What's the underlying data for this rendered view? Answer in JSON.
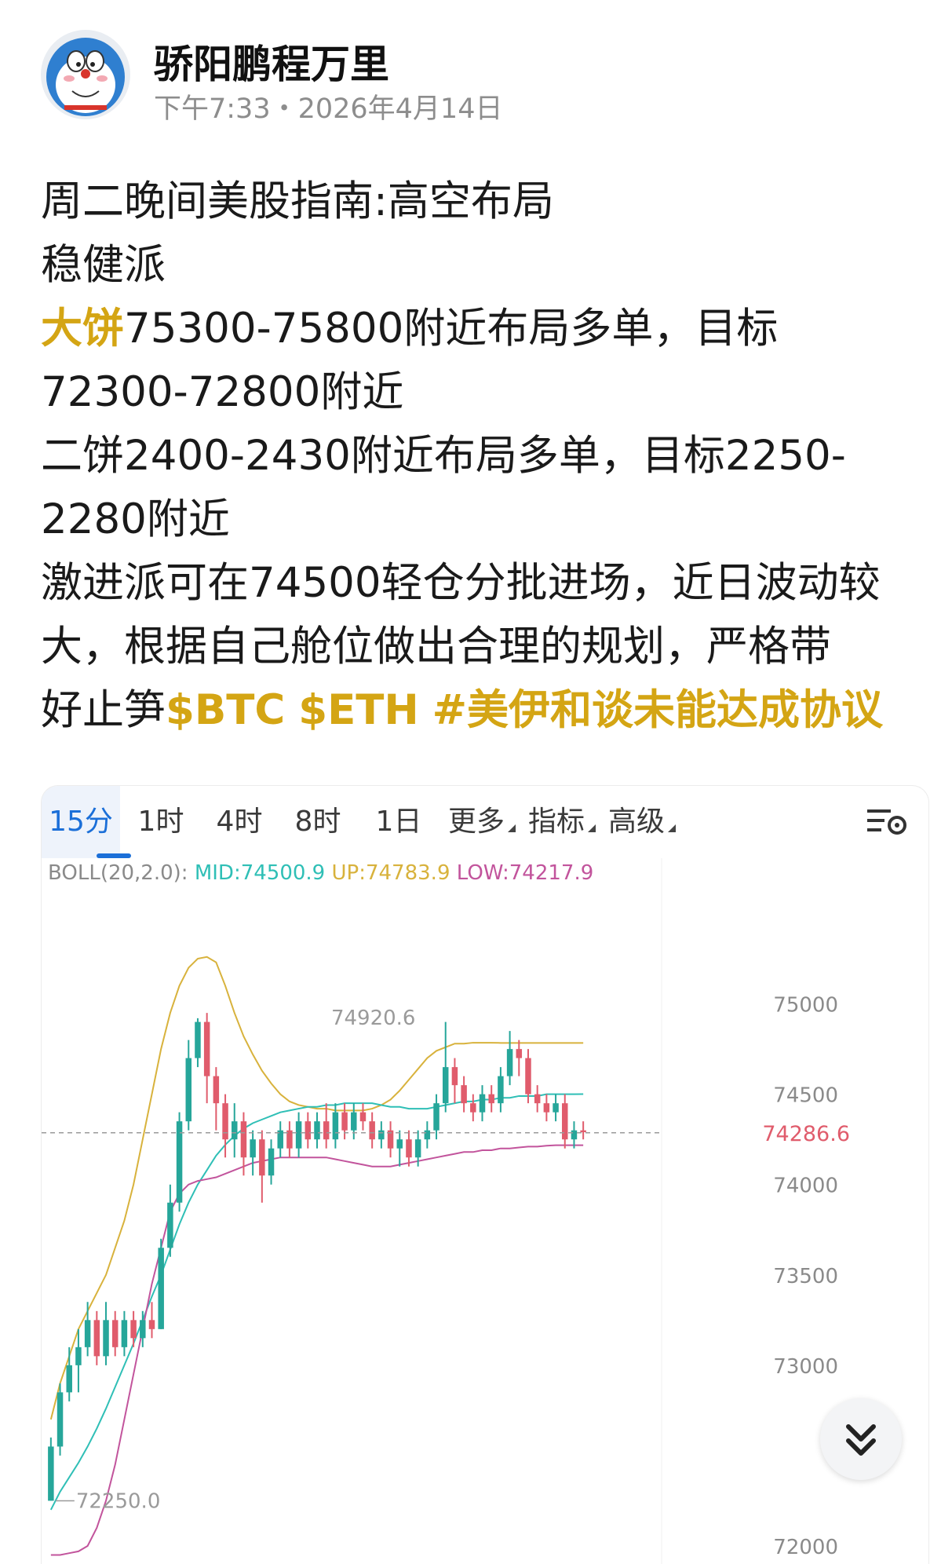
{
  "author": {
    "name": "骄阳鹏程万里",
    "time": "下午7:33・2026年4月14日"
  },
  "post": {
    "lines": [
      {
        "segments": [
          {
            "text": "周二晚间美股指南:高空布局"
          }
        ]
      },
      {
        "segments": [
          {
            "text": "稳健派"
          }
        ]
      },
      {
        "segments": [
          {
            "text": "大饼",
            "style": "hl"
          },
          {
            "text": "75300-75800附近布局多单，目标"
          }
        ]
      },
      {
        "segments": [
          {
            "text": "72300-72800附近"
          }
        ]
      },
      {
        "segments": [
          {
            "text": "二饼2400-2430附近布局多单，目标2250-"
          }
        ]
      },
      {
        "segments": [
          {
            "text": "2280附近"
          }
        ]
      },
      {
        "segments": [
          {
            "text": "激进派可在74500轻仓分批进场，近日波动较"
          }
        ]
      },
      {
        "segments": [
          {
            "text": "大，根据自己舱位做出合理的规划，严格带"
          }
        ]
      },
      {
        "segments": [
          {
            "text": "好止笋"
          },
          {
            "text": "$BTC",
            "style": "tag"
          },
          {
            "text": " "
          },
          {
            "text": "$ETH",
            "style": "tag"
          },
          {
            "text": " "
          },
          {
            "text": "#美伊和谈未能达成协议",
            "style": "tag"
          }
        ]
      }
    ]
  },
  "chart_tabs": [
    {
      "label": "15分",
      "active": true
    },
    {
      "label": "1时"
    },
    {
      "label": "4时"
    },
    {
      "label": "8时"
    },
    {
      "label": "1日"
    },
    {
      "label": "更多",
      "dropdown": true
    },
    {
      "label": "指标",
      "dropdown": true
    },
    {
      "label": "高级",
      "dropdown": true
    }
  ],
  "icons": {
    "settings": "indicator-settings-icon",
    "scroll": "double-chevron-down-icon"
  },
  "colors": {
    "accent": "#d4a514",
    "up": "#26a69a",
    "down": "#e05c6c",
    "mid": "#2fbfb6",
    "upper": "#d8b23c",
    "lower": "#c2549c",
    "active_tab": "#1b6fd8"
  },
  "chart_data": {
    "type": "candlestick",
    "indicator": {
      "name": "BOLL(20,2.0):",
      "mid_label": "MID:74500.9",
      "up_label": "UP:74783.9",
      "low_label": "LOW:74217.9"
    },
    "y_ticks": [
      "75000",
      "74500",
      "74000",
      "73500",
      "73000",
      "72000"
    ],
    "y_tick_values": [
      75000,
      74500,
      74000,
      73500,
      73000,
      72000
    ],
    "ylim": [
      71900,
      75650
    ],
    "last_price": "74286.6",
    "last_price_value": 74286.6,
    "high_label": "74920.6",
    "low_label": "72250.0",
    "candles": [
      [
        72250,
        72550,
        72250,
        72600
      ],
      [
        72550,
        72850,
        72500,
        72900
      ],
      [
        72850,
        73000,
        72800,
        73100
      ],
      [
        73000,
        73100,
        72850,
        73200
      ],
      [
        73100,
        73250,
        73050,
        73350
      ],
      [
        73250,
        73050,
        73000,
        73300
      ],
      [
        73050,
        73250,
        73000,
        73350
      ],
      [
        73250,
        73100,
        73050,
        73300
      ],
      [
        73100,
        73250,
        73050,
        73300
      ],
      [
        73250,
        73150,
        73100,
        73300
      ],
      [
        73150,
        73250,
        73100,
        73300
      ],
      [
        73250,
        73200,
        73150,
        73350
      ],
      [
        73200,
        73650,
        73200,
        73700
      ],
      [
        73650,
        73900,
        73600,
        74000
      ],
      [
        73900,
        74350,
        73850,
        74400
      ],
      [
        74350,
        74700,
        74300,
        74800
      ],
      [
        74700,
        74900,
        74650,
        74920.6
      ],
      [
        74900,
        74600,
        74450,
        74950
      ],
      [
        74600,
        74450,
        74300,
        74650
      ],
      [
        74450,
        74250,
        74150,
        74500
      ],
      [
        74250,
        74350,
        74150,
        74450
      ],
      [
        74350,
        74150,
        74050,
        74400
      ],
      [
        74150,
        74250,
        74050,
        74300
      ],
      [
        74250,
        74050,
        73900,
        74300
      ],
      [
        74050,
        74200,
        74000,
        74250
      ],
      [
        74200,
        74300,
        74150,
        74350
      ],
      [
        74300,
        74200,
        74150,
        74350
      ],
      [
        74200,
        74350,
        74150,
        74400
      ],
      [
        74350,
        74250,
        74200,
        74400
      ],
      [
        74250,
        74350,
        74200,
        74400
      ],
      [
        74350,
        74250,
        74200,
        74450
      ],
      [
        74250,
        74400,
        74200,
        74450
      ],
      [
        74400,
        74300,
        74250,
        74450
      ],
      [
        74300,
        74400,
        74250,
        74450
      ],
      [
        74400,
        74350,
        74300,
        74450
      ],
      [
        74350,
        74250,
        74200,
        74400
      ],
      [
        74250,
        74300,
        74200,
        74350
      ],
      [
        74300,
        74200,
        74150,
        74350
      ],
      [
        74200,
        74250,
        74100,
        74300
      ],
      [
        74250,
        74150,
        74100,
        74300
      ],
      [
        74150,
        74250,
        74100,
        74300
      ],
      [
        74250,
        74300,
        74200,
        74350
      ],
      [
        74300,
        74450,
        74250,
        74500
      ],
      [
        74450,
        74650,
        74400,
        74900
      ],
      [
        74650,
        74550,
        74450,
        74700
      ],
      [
        74550,
        74450,
        74400,
        74600
      ],
      [
        74450,
        74400,
        74350,
        74500
      ],
      [
        74400,
        74500,
        74350,
        74550
      ],
      [
        74500,
        74450,
        74400,
        74550
      ],
      [
        74450,
        74600,
        74400,
        74650
      ],
      [
        74600,
        74750,
        74550,
        74850
      ],
      [
        74750,
        74700,
        74600,
        74800
      ],
      [
        74700,
        74500,
        74450,
        74750
      ],
      [
        74500,
        74450,
        74400,
        74550
      ],
      [
        74450,
        74400,
        74350,
        74500
      ],
      [
        74400,
        74450,
        74350,
        74500
      ],
      [
        74450,
        74250,
        74200,
        74500
      ],
      [
        74250,
        74300,
        74200,
        74350
      ],
      [
        74300,
        74290,
        74250,
        74350
      ]
    ],
    "boll_mid": [
      72200,
      72300,
      72380,
      72460,
      72550,
      72650,
      72760,
      72880,
      73000,
      73120,
      73250,
      73380,
      73500,
      73640,
      73780,
      73900,
      74000,
      74080,
      74160,
      74220,
      74270,
      74310,
      74340,
      74360,
      74380,
      74400,
      74410,
      74420,
      74430,
      74430,
      74440,
      74440,
      74450,
      74450,
      74450,
      74450,
      74440,
      74430,
      74430,
      74420,
      74420,
      74420,
      74430,
      74440,
      74450,
      74460,
      74460,
      74470,
      74470,
      74480,
      74480,
      74490,
      74490,
      74490,
      74500,
      74500,
      74500,
      74500,
      74500.9
    ],
    "boll_up": [
      72700,
      72900,
      73050,
      73200,
      73300,
      73400,
      73500,
      73650,
      73800,
      74000,
      74250,
      74500,
      74750,
      74950,
      75100,
      75200,
      75250,
      75260,
      75230,
      75100,
      74950,
      74820,
      74720,
      74630,
      74560,
      74500,
      74460,
      74440,
      74430,
      74420,
      74420,
      74410,
      74410,
      74410,
      74410,
      74420,
      74440,
      74470,
      74520,
      74580,
      74640,
      74700,
      74740,
      74760,
      74780,
      74780,
      74785,
      74785,
      74785,
      74783.9,
      74783.9,
      74783.9,
      74783.9,
      74783.9,
      74783.9,
      74783.9,
      74783.9,
      74783.9,
      74783.9
    ],
    "boll_low": [
      71950,
      71950,
      71960,
      71970,
      72000,
      72100,
      72250,
      72450,
      72700,
      72950,
      73200,
      73450,
      73650,
      73850,
      73950,
      74000,
      74020,
      74030,
      74040,
      74060,
      74080,
      74100,
      74120,
      74130,
      74140,
      74150,
      74150,
      74150,
      74150,
      74150,
      74150,
      74140,
      74130,
      74120,
      74110,
      74100,
      74100,
      74100,
      74110,
      74120,
      74130,
      74140,
      74150,
      74160,
      74170,
      74180,
      74180,
      74190,
      74190,
      74200,
      74200,
      74205,
      74210,
      74210,
      74215,
      74217.9,
      74217.9,
      74217.9,
      74217.9
    ]
  }
}
